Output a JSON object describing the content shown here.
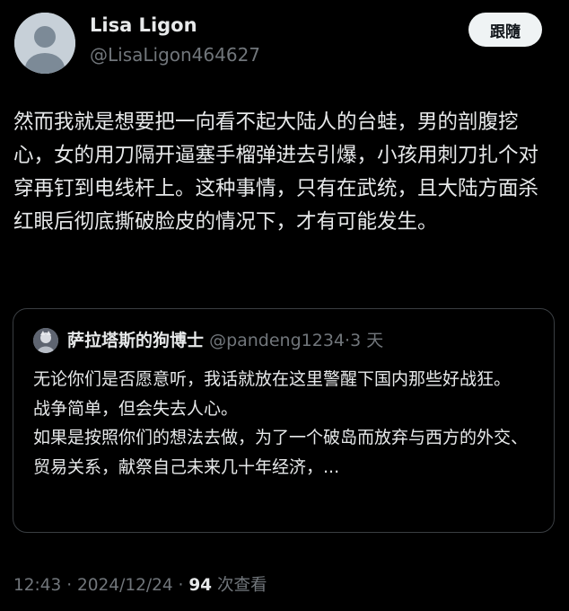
{
  "author": {
    "display_name": "Lisa Ligon",
    "handle": "@LisaLigon464627",
    "avatar_icon": "default-avatar-icon"
  },
  "follow_button": {
    "label": "跟隨"
  },
  "tweet": {
    "text": "然而我就是想要把一向看不起大陆人的台蛙，男的剖腹挖心，女的用刀隔开逼塞手榴弹进去引爆，小孩用刺刀扎个对穿再钉到电线杆上。这种事情，只有在武统，且大陆方面杀红眼后彻底撕破脸皮的情况下，才有可能发生。"
  },
  "quote": {
    "display_name": "萨拉塔斯的狗博士",
    "handle": "@pandeng1234",
    "separator": "·",
    "time": "3 天",
    "paragraphs": [
      "无论你们是否愿意听，我话就放在这里警醒下国内那些好战狂。",
      "战争简单，但会失去人心。",
      "如果是按照你们的想法去做，为了一个破岛而放弃与西方的外交、贸易关系，献祭自己未来几十年经济，..."
    ]
  },
  "meta": {
    "time": "12:43",
    "separator": "·",
    "date": "2024/12/24",
    "views_count": "94",
    "views_label": "次查看"
  },
  "colors": {
    "background": "#000000",
    "text_primary": "#e7e9ea",
    "text_secondary": "#71767b",
    "border": "#3a3e42",
    "button_bg": "#eff3f4"
  }
}
